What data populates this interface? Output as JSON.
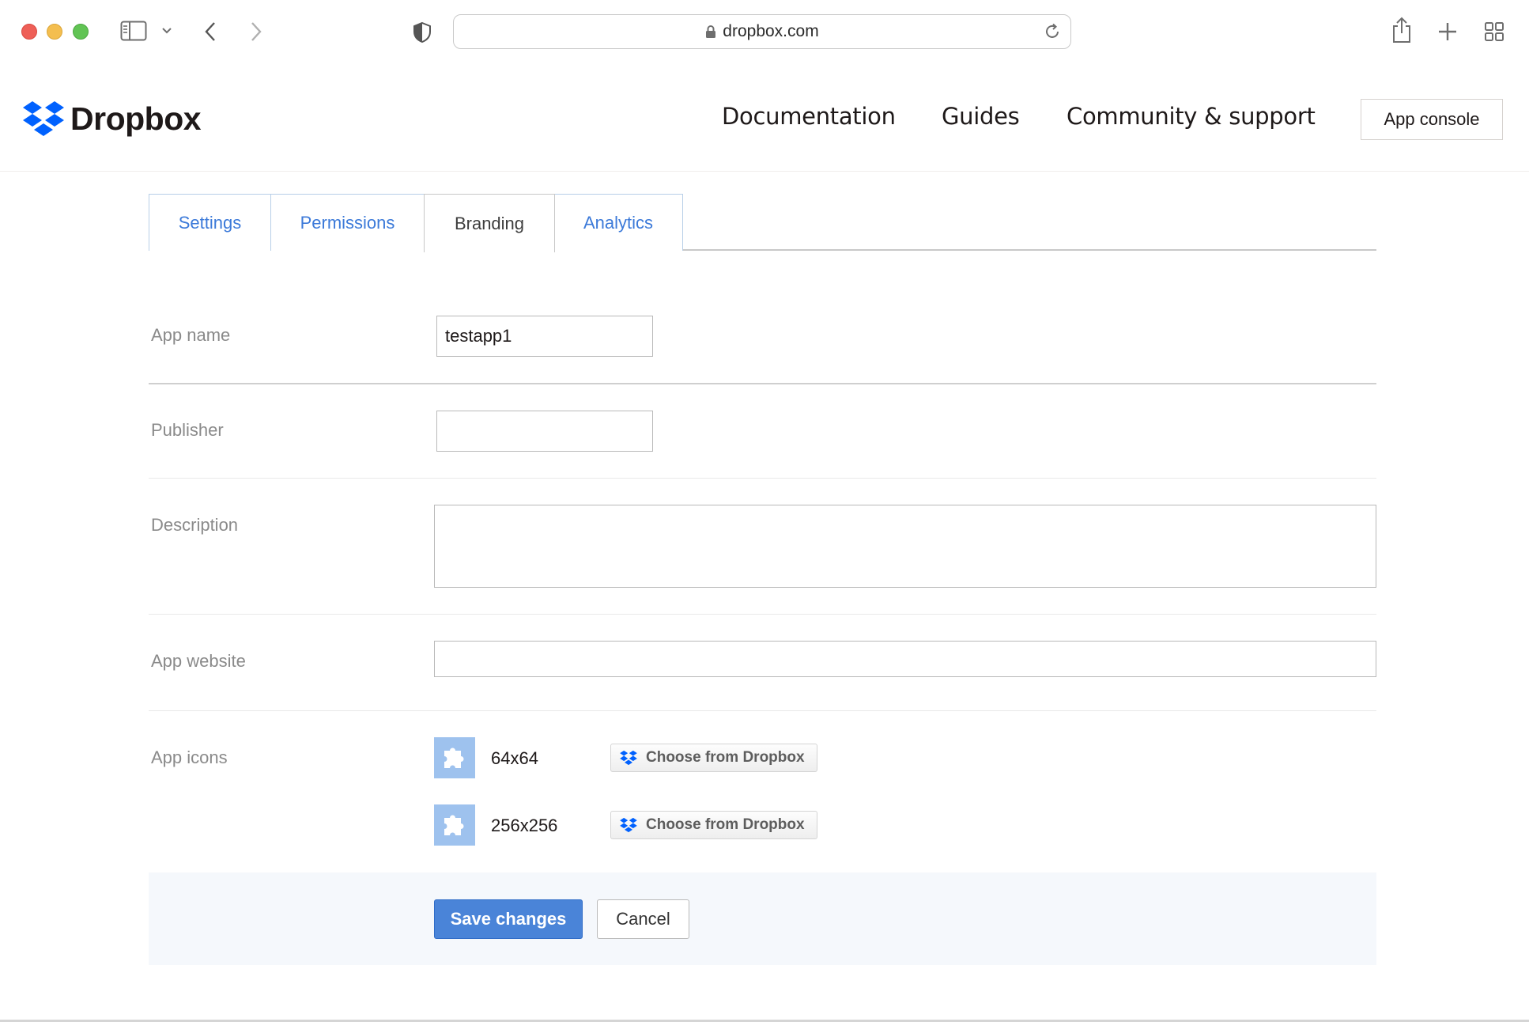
{
  "browser": {
    "url": "dropbox.com"
  },
  "header": {
    "logo_text": "Dropbox",
    "nav": [
      "Documentation",
      "Guides",
      "Community & support"
    ],
    "app_console": "App console",
    "brand_color": "#0061fe"
  },
  "tabs": [
    {
      "label": "Settings",
      "active": false
    },
    {
      "label": "Permissions",
      "active": false
    },
    {
      "label": "Branding",
      "active": true
    },
    {
      "label": "Analytics",
      "active": false
    }
  ],
  "form": {
    "app_name": {
      "label": "App name",
      "value": "testapp1"
    },
    "publisher": {
      "label": "Publisher",
      "value": ""
    },
    "description": {
      "label": "Description",
      "value": ""
    },
    "app_website": {
      "label": "App website",
      "value": ""
    },
    "app_icons": {
      "label": "App icons",
      "items": [
        {
          "size": "64x64",
          "button": "Choose from Dropbox"
        },
        {
          "size": "256x256",
          "button": "Choose from Dropbox"
        }
      ]
    }
  },
  "actions": {
    "save": "Save changes",
    "cancel": "Cancel",
    "accent_color": "#4a84d8"
  }
}
